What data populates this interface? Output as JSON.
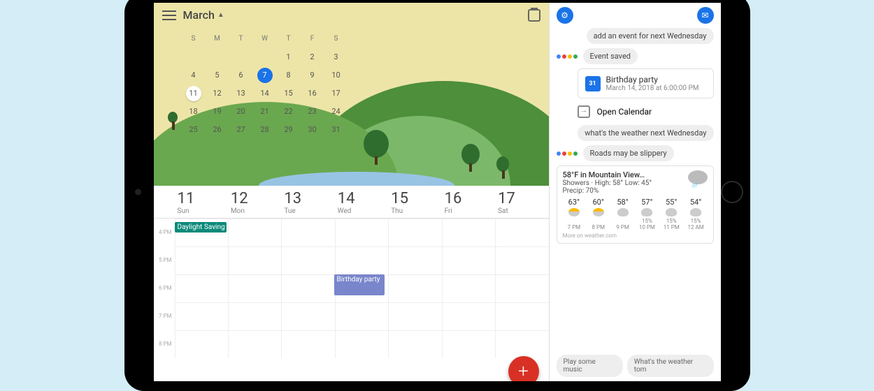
{
  "calendar": {
    "month": "March",
    "dow": [
      "S",
      "M",
      "T",
      "W",
      "T",
      "F",
      "S"
    ],
    "rows": [
      [
        "",
        "",
        "",
        "",
        "1",
        "2",
        "3"
      ],
      [
        "4",
        "5",
        "6",
        "7",
        "8",
        "9",
        "10"
      ],
      [
        "11",
        "12",
        "13",
        "14",
        "15",
        "16",
        "17"
      ],
      [
        "18",
        "19",
        "20",
        "21",
        "22",
        "23",
        "24"
      ],
      [
        "25",
        "26",
        "27",
        "28",
        "29",
        "30",
        "31"
      ]
    ],
    "selected_day": "7",
    "today_day": "11",
    "week": {
      "days": [
        {
          "num": "11",
          "name": "Sun"
        },
        {
          "num": "12",
          "name": "Mon"
        },
        {
          "num": "13",
          "name": "Tue"
        },
        {
          "num": "14",
          "name": "Wed"
        },
        {
          "num": "15",
          "name": "Thu"
        },
        {
          "num": "16",
          "name": "Fri"
        },
        {
          "num": "17",
          "name": "Sat"
        }
      ],
      "hours": [
        "4 PM",
        "5 PM",
        "6 PM",
        "7 PM",
        "8 PM"
      ],
      "allday": {
        "label": "Daylight Saving",
        "color": "#0b8a7a",
        "col": 0
      },
      "event": {
        "label": "Birthday party",
        "color": "#7986cb",
        "col": 3,
        "row": 2
      }
    },
    "fab": "+"
  },
  "assistant": {
    "user1": "add an event for next Wednesday",
    "reply1": "Event saved",
    "event_card": {
      "title": "Birthday party",
      "subtitle": "March 14, 2018 at 6:00:00 PM",
      "icon_text": "31"
    },
    "open_cal": "Open Calendar",
    "user2": "what's the weather next Wednesday",
    "reply2": "Roads may be slippery",
    "weather": {
      "headline": "58°F in Mountain View…",
      "details": "Showers · High: 58° Low: 45°",
      "precip": "Precip: 70%",
      "forecast": [
        {
          "temp": "63°",
          "pct": "",
          "time": "7 PM",
          "sun": true
        },
        {
          "temp": "60°",
          "pct": "",
          "time": "8 PM",
          "sun": true
        },
        {
          "temp": "58°",
          "pct": "",
          "time": "9 PM",
          "sun": false
        },
        {
          "temp": "57°",
          "pct": "15%",
          "time": "10 PM",
          "sun": false
        },
        {
          "temp": "55°",
          "pct": "15%",
          "time": "11 PM",
          "sun": false
        },
        {
          "temp": "54°",
          "pct": "15%",
          "time": "12 AM",
          "sun": false
        }
      ],
      "more": "More on weather.com"
    },
    "suggestions": [
      "Play some music",
      "What's the weather tom"
    ]
  }
}
